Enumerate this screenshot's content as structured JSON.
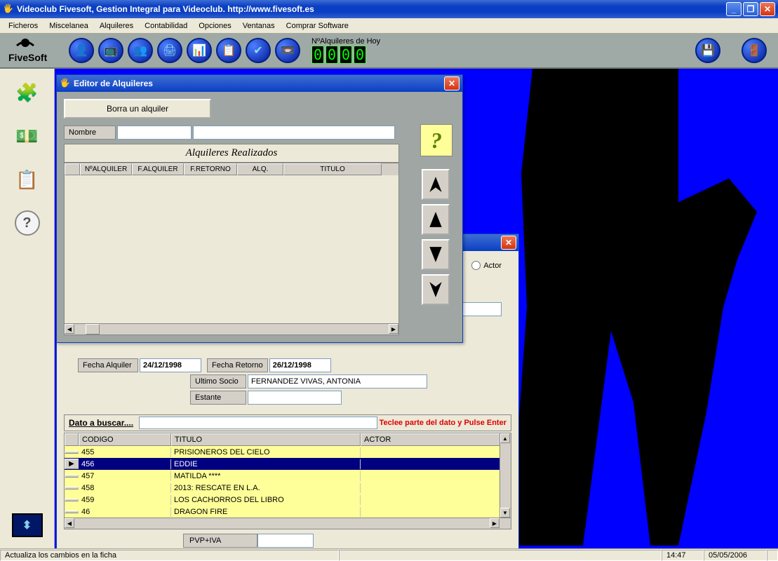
{
  "window": {
    "title": "Videoclub Fivesoft, Gestion Integral para Videoclub. http://www.fivesoft.es"
  },
  "menu": {
    "items": [
      "Ficheros",
      "Miscelanea",
      "Alquileres",
      "Contabilidad",
      "Opciones",
      "Ventanas",
      "Comprar Software"
    ]
  },
  "toolbar": {
    "counter_label": "NºAlquileres de Hoy",
    "counter_digits": [
      "0",
      "0",
      "0",
      "0"
    ]
  },
  "editor": {
    "title": "Editor de Alquileres",
    "delete_btn": "Borra un alquiler",
    "name_label": "Nombre",
    "grid_title": "Alquileres Realizados",
    "columns": [
      "NºALQUILER",
      "F.ALQUILER",
      "F.RETORNO",
      "ALQ.",
      "TITULO"
    ]
  },
  "bg_window": {
    "radio_actor": "Actor",
    "fecha_alq_label": "Fecha Alquiler",
    "fecha_alq_val": "24/12/1998",
    "fecha_ret_label": "Fecha Retorno",
    "fecha_ret_val": "26/12/1998",
    "ultimo_socio_label": "Ultimo Socio",
    "ultimo_socio_val": "FERNANDEZ VIVAS, ANTONIA",
    "estante_label": "Estante",
    "estante_val": "",
    "search_label": "Dato a buscar....",
    "search_hint": "Teclee parte del dato y Pulse Enter",
    "grid_headers": {
      "codigo": "CODIGO",
      "titulo": "TITULO",
      "actor": "ACTOR"
    },
    "rows": [
      {
        "code": "455",
        "title": "PRISIONEROS DEL CIELO",
        "actor": ""
      },
      {
        "code": "456",
        "title": "EDDIE",
        "actor": ""
      },
      {
        "code": "457",
        "title": "MATILDA ****",
        "actor": ""
      },
      {
        "code": "458",
        "title": "2013: RESCATE EN L.A.",
        "actor": ""
      },
      {
        "code": "459",
        "title": "LOS CACHORROS DEL LIBRO",
        "actor": ""
      },
      {
        "code": "46",
        "title": "DRAGON FIRE",
        "actor": ""
      }
    ],
    "selected_index": 1,
    "pvp_label": "PVP+IVA"
  },
  "status": {
    "text": "Actualiza los cambios en la ficha",
    "time": "14:47",
    "date": "05/05/2006"
  }
}
